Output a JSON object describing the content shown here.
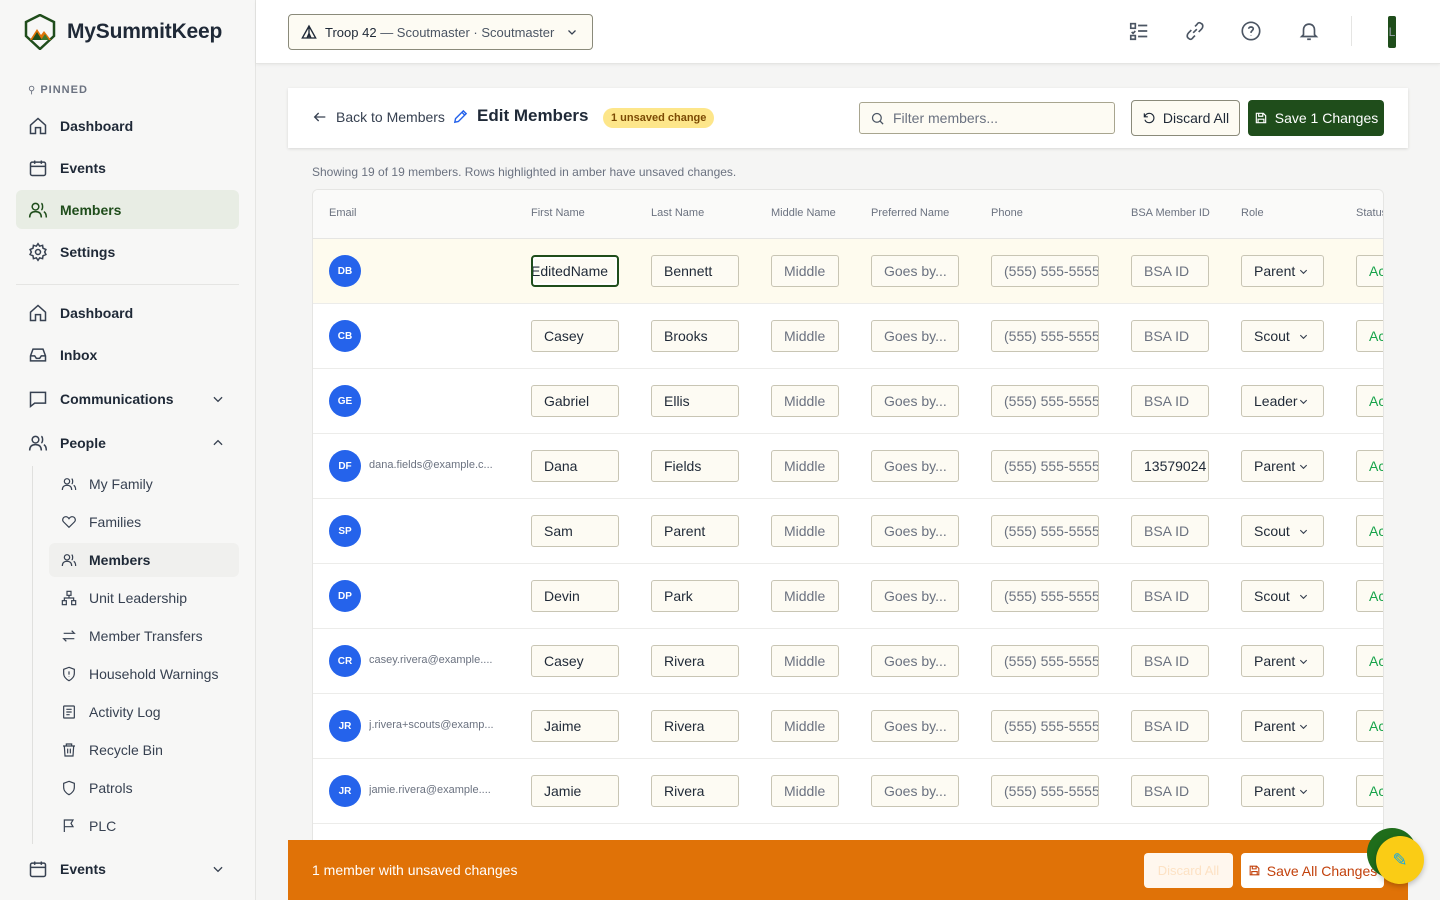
{
  "brand": {
    "name": "MySummitKeep"
  },
  "sidebar": {
    "pinned_label": "PINNED",
    "pinned": [
      {
        "label": "Dashboard",
        "icon": "home-icon"
      },
      {
        "label": "Events",
        "icon": "calendar-icon"
      },
      {
        "label": "Members",
        "icon": "users-icon",
        "active": true
      },
      {
        "label": "Settings",
        "icon": "gear-icon"
      }
    ],
    "main": [
      {
        "label": "Dashboard",
        "icon": "home-icon"
      },
      {
        "label": "Inbox",
        "icon": "inbox-icon"
      },
      {
        "label": "Communications",
        "icon": "message-icon",
        "expandable": true
      },
      {
        "label": "People",
        "icon": "users-icon",
        "expanded": true
      }
    ],
    "people_sub": [
      {
        "label": "My Family",
        "icon": "user-group-icon"
      },
      {
        "label": "Families",
        "icon": "heart-icon"
      },
      {
        "label": "Members",
        "icon": "users-icon",
        "active": true
      },
      {
        "label": "Unit Leadership",
        "icon": "org-chart-icon"
      },
      {
        "label": "Member Transfers",
        "icon": "transfer-icon"
      },
      {
        "label": "Household Warnings",
        "icon": "shield-alert-icon"
      },
      {
        "label": "Activity Log",
        "icon": "log-icon"
      },
      {
        "label": "Recycle Bin",
        "icon": "trash-icon"
      },
      {
        "label": "Patrols",
        "icon": "shield-icon"
      },
      {
        "label": "PLC",
        "icon": "flag-icon"
      }
    ],
    "events_bottom": "Events"
  },
  "topbar": {
    "troop": "Troop 42",
    "troop_role": "— Scoutmaster · Scoutmaster",
    "avatar_initial": "L"
  },
  "header": {
    "back_label": "Back to Members",
    "title": "Edit Members",
    "badge": "1 unsaved change",
    "filter_placeholder": "Filter members...",
    "discard_label": "Discard All",
    "save_label": "Save 1 Changes"
  },
  "showing_text": "Showing 19 of 19 members. Rows highlighted in amber have unsaved changes.",
  "table": {
    "columns": [
      "Email",
      "First Name",
      "Last Name",
      "Middle Name",
      "Preferred Name",
      "Phone",
      "BSA Member ID",
      "Role",
      "Status"
    ],
    "placeholders": {
      "middle": "Middle",
      "preferred": "Goes by...",
      "phone": "(555) 555-5555",
      "bsa": "BSA ID"
    },
    "rows": [
      {
        "initials": "DB",
        "email": "",
        "first": "EditedName",
        "last": "Bennett",
        "bsa": "",
        "role": "Parent",
        "status": "Ac",
        "dirty": true
      },
      {
        "initials": "CB",
        "email": "",
        "first": "Casey",
        "last": "Brooks",
        "bsa": "",
        "role": "Scout",
        "status": "Ac"
      },
      {
        "initials": "GE",
        "email": "",
        "first": "Gabriel",
        "last": "Ellis",
        "bsa": "",
        "role": "Leader",
        "status": "Ac"
      },
      {
        "initials": "DF",
        "email": "dana.fields@example.c...",
        "first": "Dana",
        "last": "Fields",
        "bsa": "13579024",
        "role": "Parent",
        "status": "Ac"
      },
      {
        "initials": "SP",
        "email": "",
        "first": "Sam",
        "last": "Parent",
        "bsa": "",
        "role": "Scout",
        "status": "Ac"
      },
      {
        "initials": "DP",
        "email": "",
        "first": "Devin",
        "last": "Park",
        "bsa": "",
        "role": "Scout",
        "status": "Ac"
      },
      {
        "initials": "CR",
        "email": "casey.rivera@example....",
        "first": "Casey",
        "last": "Rivera",
        "bsa": "",
        "role": "Parent",
        "status": "Ac"
      },
      {
        "initials": "JR",
        "email": "j.rivera+scouts@examp...",
        "first": "Jaime",
        "last": "Rivera",
        "bsa": "",
        "role": "Parent",
        "status": "Ac"
      },
      {
        "initials": "JR",
        "email": "jamie.rivera@example....",
        "first": "Jamie",
        "last": "Rivera",
        "bsa": "",
        "role": "Parent",
        "status": "Ac"
      }
    ]
  },
  "bottom_bar": {
    "text": "1 member with unsaved changes",
    "discard_label": "Discard All",
    "save_label": "Save All Changes"
  },
  "colors": {
    "brand_green": "#1f4d1b",
    "warning_orange": "#e07207",
    "avatar_blue": "#2563eb",
    "dirty_row": "#fefbee"
  }
}
